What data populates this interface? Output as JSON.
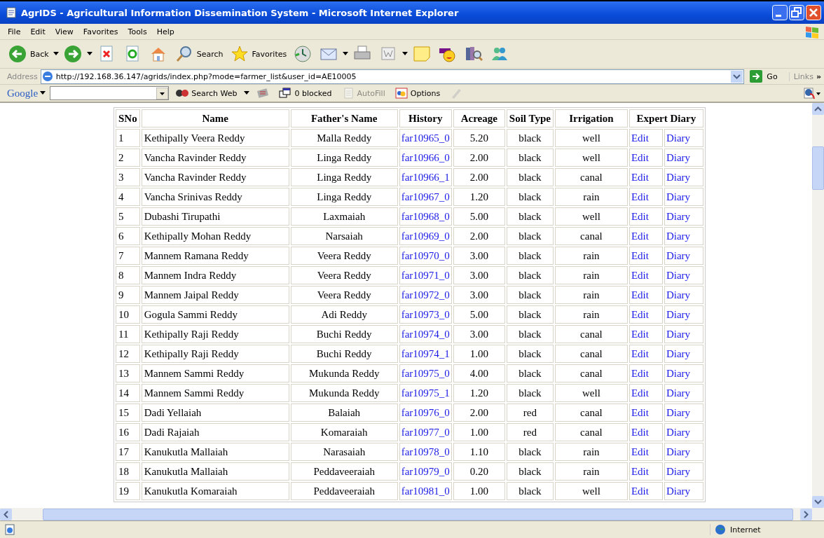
{
  "window": {
    "title": "AgrIDS - Agricultural Information Dissemination System - Microsoft Internet Explorer"
  },
  "menu": [
    "File",
    "Edit",
    "View",
    "Favorites",
    "Tools",
    "Help"
  ],
  "toolbar": [
    {
      "kind": "back",
      "label": "Back",
      "dropdown": true
    },
    {
      "kind": "forward",
      "dropdown": true
    },
    {
      "kind": "stop",
      "dropdown": false
    },
    {
      "kind": "refresh",
      "dropdown": false
    },
    {
      "kind": "home",
      "dropdown": false
    },
    {
      "kind": "search",
      "label": "Search",
      "dropdown": false
    },
    {
      "kind": "favorites",
      "label": "Favorites",
      "dropdown": false
    },
    {
      "kind": "history",
      "dropdown": false
    },
    {
      "kind": "mail",
      "dropdown": true
    },
    {
      "kind": "print",
      "dropdown": false
    },
    {
      "kind": "word",
      "dropdown": true
    },
    {
      "kind": "note",
      "dropdown": false
    },
    {
      "kind": "messenger",
      "dropdown": false
    },
    {
      "kind": "research",
      "dropdown": false
    },
    {
      "kind": "people",
      "dropdown": false
    }
  ],
  "address_bar": {
    "label": "Address",
    "url": "http://192.168.36.147/agrids/index.php?mode=farmer_list&user_id=AE10005",
    "go": "Go",
    "links": "Links",
    "more": "»"
  },
  "google_bar": {
    "logo": "Google",
    "items": [
      {
        "kind": "search",
        "label": "Search Web",
        "disabled": false
      },
      {
        "kind": "news",
        "disabled": false
      },
      {
        "kind": "popup",
        "label": "0 blocked",
        "disabled": false
      },
      {
        "kind": "autofill",
        "label": "AutoFill",
        "disabled": true
      },
      {
        "kind": "options",
        "label": "Options",
        "disabled": false
      },
      {
        "kind": "pen",
        "disabled": true
      }
    ]
  },
  "table": {
    "columns": [
      "SNo",
      "Name",
      "Father's Name",
      "History",
      "Acreage",
      "Soil Type",
      "Irrigation",
      "Expert Diary"
    ],
    "rows": [
      {
        "sno": "1",
        "name": "Kethipally Veera Reddy",
        "father": "Malla Reddy",
        "history": "far10965_0",
        "acreage": "5.20",
        "soil": "black",
        "irrigation": "well",
        "edit": "Edit",
        "diary": "Diary"
      },
      {
        "sno": "2",
        "name": "Vancha Ravinder Reddy",
        "father": "Linga Reddy",
        "history": "far10966_0",
        "acreage": "2.00",
        "soil": "black",
        "irrigation": "well",
        "edit": "Edit",
        "diary": "Diary"
      },
      {
        "sno": "3",
        "name": "Vancha Ravinder Reddy",
        "father": "Linga Reddy",
        "history": "far10966_1",
        "acreage": "2.00",
        "soil": "black",
        "irrigation": "canal",
        "edit": "Edit",
        "diary": "Diary"
      },
      {
        "sno": "4",
        "name": "Vancha Srinivas Reddy",
        "father": "Linga Reddy",
        "history": "far10967_0",
        "acreage": "1.20",
        "soil": "black",
        "irrigation": "rain",
        "edit": "Edit",
        "diary": "Diary"
      },
      {
        "sno": "5",
        "name": "Dubashi Tirupathi",
        "father": "Laxmaiah",
        "history": "far10968_0",
        "acreage": "5.00",
        "soil": "black",
        "irrigation": "well",
        "edit": "Edit",
        "diary": "Diary"
      },
      {
        "sno": "6",
        "name": "Kethipally Mohan Reddy",
        "father": "Narsaiah",
        "history": "far10969_0",
        "acreage": "2.00",
        "soil": "black",
        "irrigation": "canal",
        "edit": "Edit",
        "diary": "Diary"
      },
      {
        "sno": "7",
        "name": "Mannem Ramana Reddy",
        "father": "Veera Reddy",
        "history": "far10970_0",
        "acreage": "3.00",
        "soil": "black",
        "irrigation": "rain",
        "edit": "Edit",
        "diary": "Diary"
      },
      {
        "sno": "8",
        "name": "Mannem Indra Reddy",
        "father": "Veera Reddy",
        "history": "far10971_0",
        "acreage": "3.00",
        "soil": "black",
        "irrigation": "rain",
        "edit": "Edit",
        "diary": "Diary"
      },
      {
        "sno": "9",
        "name": "Mannem Jaipal Reddy",
        "father": "Veera Reddy",
        "history": "far10972_0",
        "acreage": "3.00",
        "soil": "black",
        "irrigation": "rain",
        "edit": "Edit",
        "diary": "Diary"
      },
      {
        "sno": "10",
        "name": "Gogula Sammi Reddy",
        "father": "Adi Reddy",
        "history": "far10973_0",
        "acreage": "5.00",
        "soil": "black",
        "irrigation": "rain",
        "edit": "Edit",
        "diary": "Diary"
      },
      {
        "sno": "11",
        "name": "Kethipally Raji Reddy",
        "father": "Buchi Reddy",
        "history": "far10974_0",
        "acreage": "3.00",
        "soil": "black",
        "irrigation": "canal",
        "edit": "Edit",
        "diary": "Diary"
      },
      {
        "sno": "12",
        "name": "Kethipally Raji Reddy",
        "father": "Buchi Reddy",
        "history": "far10974_1",
        "acreage": "1.00",
        "soil": "black",
        "irrigation": "canal",
        "edit": "Edit",
        "diary": "Diary"
      },
      {
        "sno": "13",
        "name": "Mannem Sammi Reddy",
        "father": "Mukunda Reddy",
        "history": "far10975_0",
        "acreage": "4.00",
        "soil": "black",
        "irrigation": "canal",
        "edit": "Edit",
        "diary": "Diary"
      },
      {
        "sno": "14",
        "name": "Mannem Sammi Reddy",
        "father": "Mukunda Reddy",
        "history": "far10975_1",
        "acreage": "1.20",
        "soil": "black",
        "irrigation": "well",
        "edit": "Edit",
        "diary": "Diary"
      },
      {
        "sno": "15",
        "name": "Dadi Yellaiah",
        "father": "Balaiah",
        "history": "far10976_0",
        "acreage": "2.00",
        "soil": "red",
        "irrigation": "canal",
        "edit": "Edit",
        "diary": "Diary"
      },
      {
        "sno": "16",
        "name": "Dadi Rajaiah",
        "father": "Komaraiah",
        "history": "far10977_0",
        "acreage": "1.00",
        "soil": "red",
        "irrigation": "canal",
        "edit": "Edit",
        "diary": "Diary"
      },
      {
        "sno": "17",
        "name": "Kanukutla Mallaiah",
        "father": "Narasaiah",
        "history": "far10978_0",
        "acreage": "1.10",
        "soil": "black",
        "irrigation": "rain",
        "edit": "Edit",
        "diary": "Diary"
      },
      {
        "sno": "18",
        "name": "Kanukutla Mallaiah",
        "father": "Peddaveeraiah",
        "history": "far10979_0",
        "acreage": "0.20",
        "soil": "black",
        "irrigation": "rain",
        "edit": "Edit",
        "diary": "Diary"
      },
      {
        "sno": "19",
        "name": "Kanukutla Komaraiah",
        "father": "Peddaveeraiah",
        "history": "far10981_0",
        "acreage": "1.00",
        "soil": "black",
        "irrigation": "well",
        "edit": "Edit",
        "diary": "Diary"
      }
    ]
  },
  "status_bar": {
    "zone": "Internet"
  }
}
